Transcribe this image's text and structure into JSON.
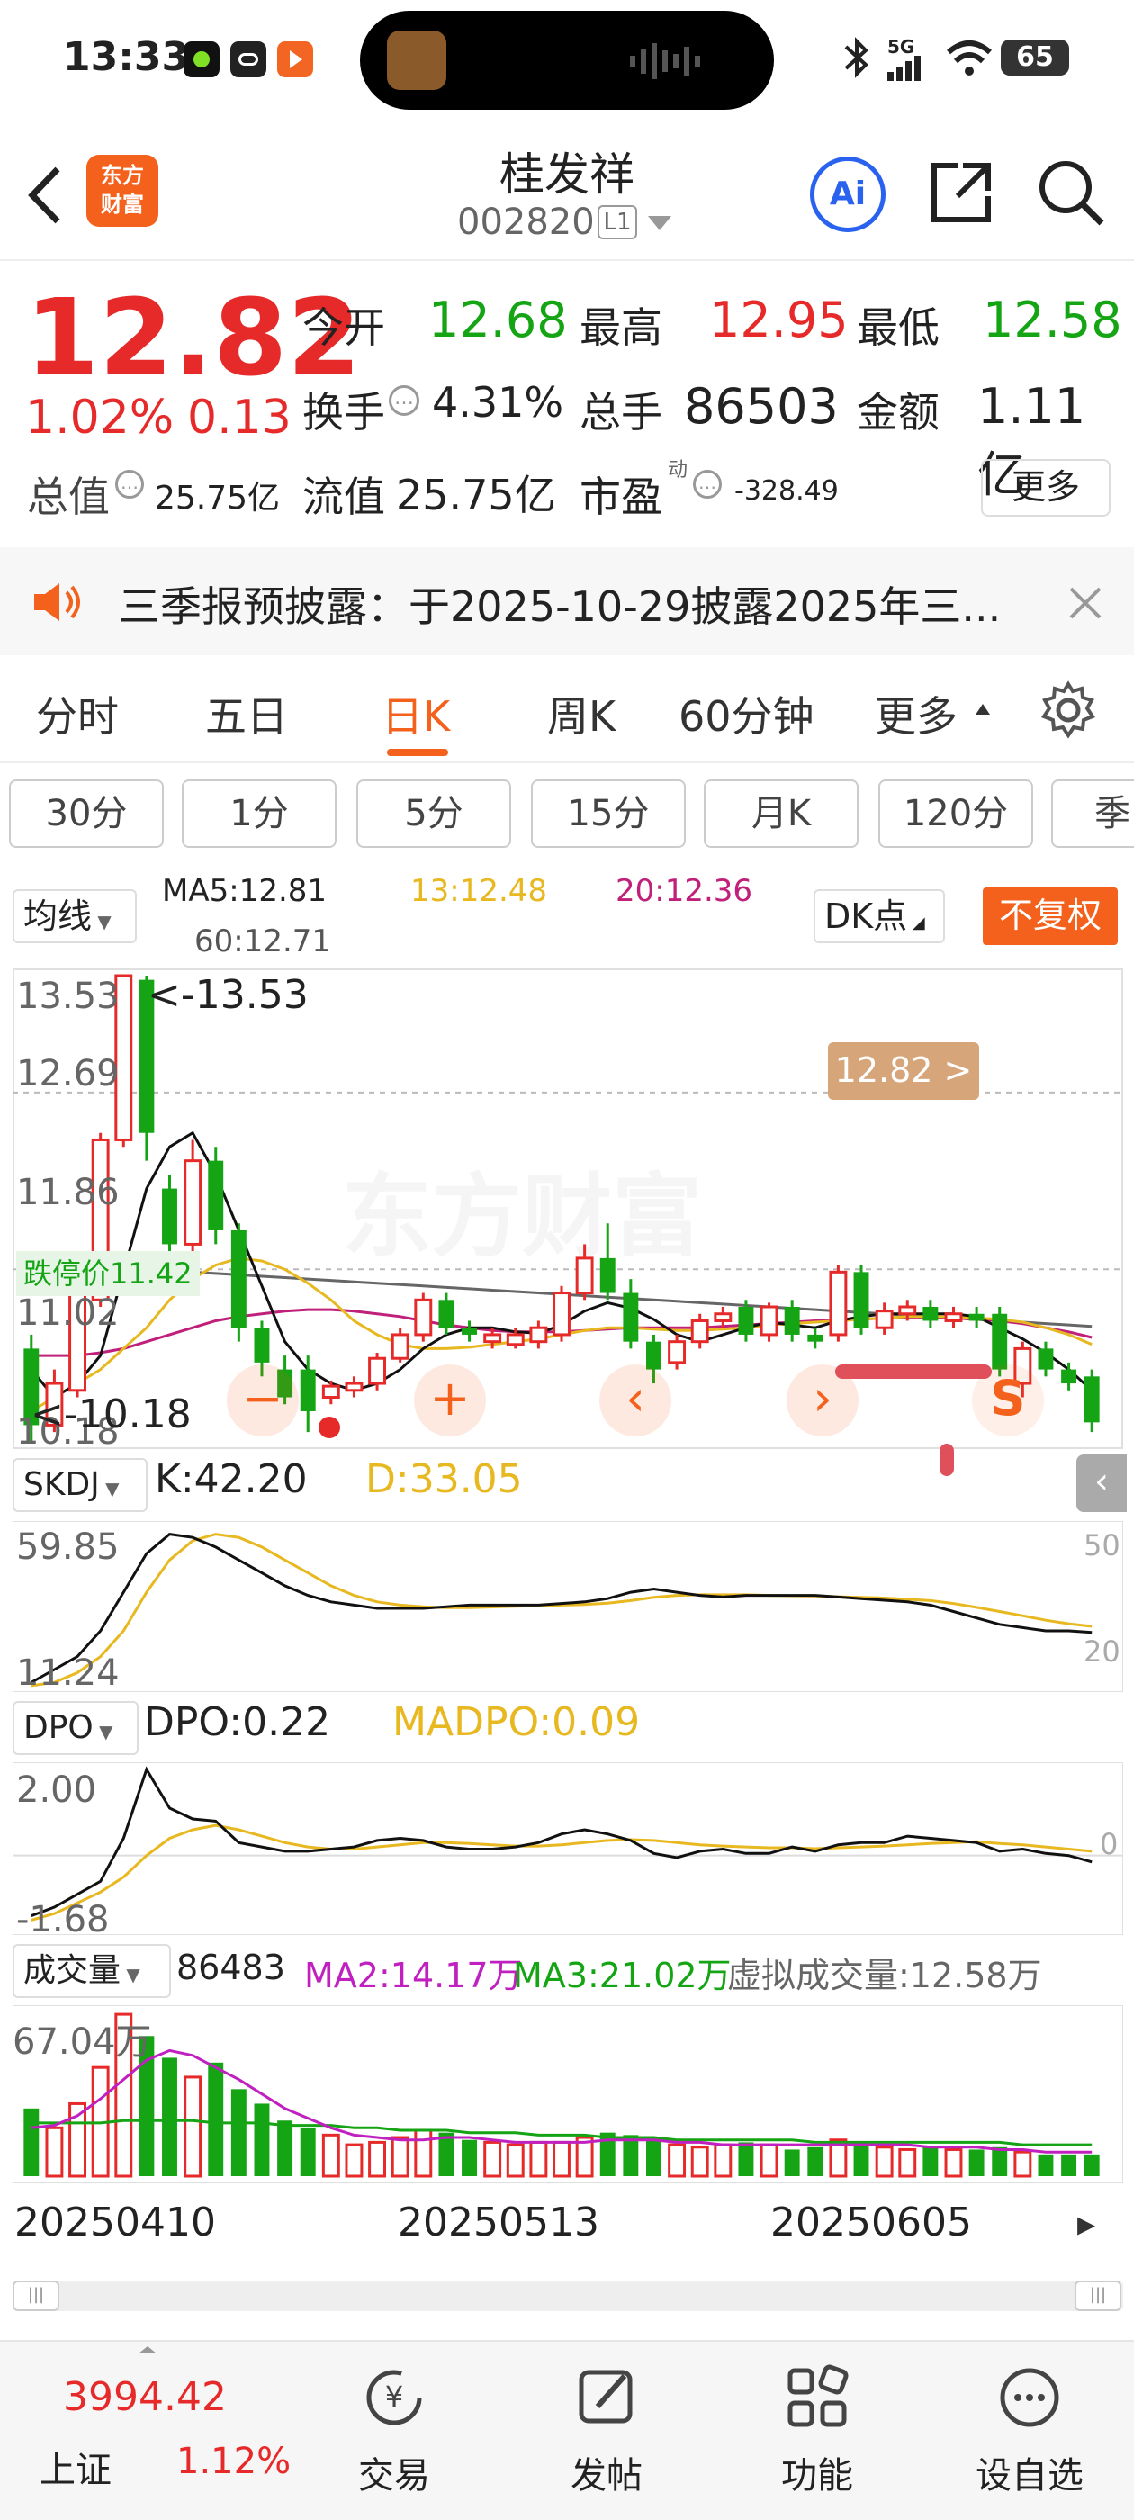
{
  "status": {
    "time": "13:33",
    "signal": "5G",
    "battery": "65"
  },
  "stock": {
    "name": "桂发祥",
    "code": "002820",
    "level": "L1",
    "logo_text_1": "东方",
    "logo_text_2": "财富",
    "ai": "Ai"
  },
  "quote": {
    "price": "12.82",
    "change_pct": "1.02%",
    "change": "0.13",
    "open_label": "今开",
    "open": "12.68",
    "high_label": "最高",
    "high": "12.95",
    "low_label": "最低",
    "low": "12.58",
    "turnover_label": "换手",
    "turnover": "4.31%",
    "volume_label": "总手",
    "volume": "86503",
    "amount_label": "金额",
    "amount": "1.11亿",
    "mktcap_label": "总值",
    "mktcap": "25.75亿",
    "float_label": "流值",
    "float": "25.75亿",
    "pe_label": "市盈",
    "pe_sup": "动",
    "pe": "-328.49",
    "more": "更多"
  },
  "notice": {
    "text": "三季报预披露：于2025-10-29披露2025年三..."
  },
  "tabs": [
    "分时",
    "五日",
    "日K",
    "周K",
    "60分钟",
    "更多"
  ],
  "active_tab": "日K",
  "periods": [
    "30分",
    "1分",
    "5分",
    "15分",
    "月K",
    "120分",
    "季"
  ],
  "ma": {
    "selector": "均线",
    "ma5": "MA5:12.81",
    "ma13": "13:12.48",
    "ma20": "20:12.36",
    "ma60": "60:12.71",
    "dk": "DK点",
    "fq": "不复权"
  },
  "kline": {
    "y_max": "13.53",
    "y_12_69": "12.69",
    "y_11_86": "11.86",
    "y_11_02": "11.02",
    "y_min": "10.18",
    "high_marker": "<-13.53",
    "low_marker": "<-10.18",
    "current_tag": "12.82 >",
    "limit_down": "跌停价11.42",
    "watermark": "东方财富"
  },
  "skdj": {
    "name": "SKDJ",
    "k": "K:42.20",
    "d": "D:33.05",
    "y_top": "59.85",
    "y_bot": "11.24",
    "r50": "50",
    "r20": "20"
  },
  "dpo": {
    "name": "DPO",
    "dpo": "DPO:0.22",
    "madpo": "MADPO:0.09",
    "y_top": "2.00",
    "y_bot": "-1.68",
    "r0": "0"
  },
  "vol": {
    "name": "成交量",
    "v": "86483",
    "ma2": "MA2:14.17万",
    "ma3": "MA3:21.02万",
    "virtual": "虚拟成交量:12.58万",
    "y_top": "67.04万"
  },
  "dates": [
    "20250410",
    "20250513",
    "20250605"
  ],
  "market": {
    "index": "3994.42",
    "name": "上证",
    "pct": "1.12%"
  },
  "bottom_nav": [
    "交易",
    "发帖",
    "功能",
    "设自选"
  ],
  "colors": {
    "up": "#e62a2a",
    "down": "#14a414",
    "accent": "#f3611c",
    "ma13": "#e8b820",
    "ma20": "#c0207a",
    "ma60": "#666666"
  },
  "chart_data": {
    "type": "candlestick",
    "candles": [
      {
        "o": 10.85,
        "c": 10.3,
        "h": 10.95,
        "l": 10.18
      },
      {
        "o": 10.3,
        "c": 10.6,
        "h": 10.7,
        "l": 10.25
      },
      {
        "o": 10.55,
        "c": 11.25,
        "h": 11.3,
        "l": 10.5
      },
      {
        "o": 11.2,
        "c": 12.35,
        "h": 12.4,
        "l": 11.15
      },
      {
        "o": 12.35,
        "c": 13.53,
        "h": 13.53,
        "l": 12.3
      },
      {
        "o": 13.5,
        "c": 12.4,
        "h": 13.53,
        "l": 12.2
      },
      {
        "o": 12.0,
        "c": 11.6,
        "h": 12.1,
        "l": 11.5
      },
      {
        "o": 11.6,
        "c": 12.2,
        "h": 12.35,
        "l": 11.55
      },
      {
        "o": 12.2,
        "c": 11.7,
        "h": 12.3,
        "l": 11.6
      },
      {
        "o": 11.7,
        "c": 11.0,
        "h": 11.75,
        "l": 10.9
      },
      {
        "o": 11.0,
        "c": 10.75,
        "h": 11.05,
        "l": 10.65
      },
      {
        "o": 10.7,
        "c": 10.5,
        "h": 10.8,
        "l": 10.45
      },
      {
        "o": 10.7,
        "c": 10.4,
        "h": 10.8,
        "l": 10.25
      },
      {
        "o": 10.5,
        "c": 10.58,
        "h": 10.62,
        "l": 10.45
      },
      {
        "o": 10.55,
        "c": 10.6,
        "h": 10.65,
        "l": 10.5
      },
      {
        "o": 10.6,
        "c": 10.78,
        "h": 10.82,
        "l": 10.55
      },
      {
        "o": 10.78,
        "c": 10.95,
        "h": 11.0,
        "l": 10.75
      },
      {
        "o": 10.95,
        "c": 11.2,
        "h": 11.25,
        "l": 10.9
      },
      {
        "o": 11.2,
        "c": 11.0,
        "h": 11.25,
        "l": 10.95
      },
      {
        "o": 11.0,
        "c": 10.95,
        "h": 11.05,
        "l": 10.9
      },
      {
        "o": 10.9,
        "c": 10.95,
        "h": 11.0,
        "l": 10.85
      },
      {
        "o": 10.88,
        "c": 10.95,
        "h": 11.0,
        "l": 10.85
      },
      {
        "o": 10.9,
        "c": 11.0,
        "h": 11.05,
        "l": 10.85
      },
      {
        "o": 10.95,
        "c": 11.25,
        "h": 11.3,
        "l": 10.9
      },
      {
        "o": 11.25,
        "c": 11.5,
        "h": 11.6,
        "l": 11.2
      },
      {
        "o": 11.5,
        "c": 11.25,
        "h": 11.75,
        "l": 11.2
      },
      {
        "o": 11.25,
        "c": 10.9,
        "h": 11.35,
        "l": 10.85
      },
      {
        "o": 10.9,
        "c": 10.7,
        "h": 10.95,
        "l": 10.6
      },
      {
        "o": 10.75,
        "c": 10.9,
        "h": 10.95,
        "l": 10.7
      },
      {
        "o": 10.9,
        "c": 11.05,
        "h": 11.1,
        "l": 10.85
      },
      {
        "o": 11.05,
        "c": 11.1,
        "h": 11.15,
        "l": 11.0
      },
      {
        "o": 11.15,
        "c": 10.95,
        "h": 11.2,
        "l": 10.9
      },
      {
        "o": 10.95,
        "c": 11.15,
        "h": 11.18,
        "l": 10.9
      },
      {
        "o": 11.15,
        "c": 10.95,
        "h": 11.2,
        "l": 10.9
      },
      {
        "o": 10.95,
        "c": 10.9,
        "h": 11.0,
        "l": 10.85
      },
      {
        "o": 10.95,
        "c": 11.4,
        "h": 11.45,
        "l": 10.9
      },
      {
        "o": 11.4,
        "c": 11.0,
        "h": 11.45,
        "l": 10.95
      },
      {
        "o": 11.0,
        "c": 11.12,
        "h": 11.18,
        "l": 10.95
      },
      {
        "o": 11.1,
        "c": 11.15,
        "h": 11.2,
        "l": 11.05
      },
      {
        "o": 11.15,
        "c": 11.05,
        "h": 11.2,
        "l": 11.0
      },
      {
        "o": 11.05,
        "c": 11.1,
        "h": 11.15,
        "l": 11.0
      },
      {
        "o": 11.1,
        "c": 11.05,
        "h": 11.15,
        "l": 11.0
      },
      {
        "o": 11.1,
        "c": 10.7,
        "h": 11.15,
        "l": 10.65
      },
      {
        "o": 10.6,
        "c": 10.85,
        "h": 10.9,
        "l": 10.5
      },
      {
        "o": 10.85,
        "c": 10.7,
        "h": 10.9,
        "l": 10.65
      },
      {
        "o": 10.7,
        "c": 10.6,
        "h": 10.75,
        "l": 10.55
      },
      {
        "o": 10.65,
        "c": 10.32,
        "h": 10.7,
        "l": 10.25
      }
    ],
    "ma5": [
      10.7,
      10.5,
      10.6,
      10.8,
      11.4,
      12.0,
      12.3,
      12.4,
      12.1,
      11.7,
      11.3,
      10.9,
      10.7,
      10.6,
      10.55,
      10.6,
      10.7,
      10.85,
      10.95,
      11.0,
      11.0,
      10.97,
      10.96,
      11.02,
      11.12,
      11.18,
      11.14,
      11.06,
      10.95,
      10.9,
      10.95,
      11.0,
      11.04,
      11.02,
      11.0,
      11.05,
      11.08,
      11.1,
      11.1,
      11.1,
      11.1,
      11.08,
      11.0,
      10.92,
      10.82,
      10.7,
      10.55
    ],
    "ma13": [
      10.4,
      10.5,
      10.6,
      10.7,
      10.85,
      11.0,
      11.2,
      11.35,
      11.45,
      11.5,
      11.48,
      11.42,
      11.32,
      11.2,
      11.05,
      10.95,
      10.88,
      10.85,
      10.85,
      10.86,
      10.88,
      10.9,
      10.92,
      10.95,
      10.98,
      11.0,
      11.0,
      10.99,
      10.98,
      10.98,
      10.99,
      11.0,
      11.02,
      11.03,
      11.04,
      11.05,
      11.06,
      11.07,
      11.08,
      11.08,
      11.08,
      11.07,
      11.06,
      11.04,
      11.0,
      10.95,
      10.88
    ],
    "ma20": [
      10.8,
      10.8,
      10.8,
      10.82,
      10.85,
      10.9,
      10.95,
      11.0,
      11.05,
      11.08,
      11.1,
      11.12,
      11.13,
      11.13,
      11.12,
      11.1,
      11.08,
      11.05,
      11.02,
      11.0,
      10.98,
      10.97,
      10.97,
      10.97,
      10.98,
      10.99,
      11.0,
      11.0,
      11.0,
      11.0,
      11.01,
      11.02,
      11.03,
      11.04,
      11.05,
      11.06,
      11.06,
      11.07,
      11.07,
      11.07,
      11.07,
      11.06,
      11.05,
      11.03,
      11.0,
      10.97,
      10.93
    ],
    "ma60": [
      11.5,
      11.48,
      11.46,
      11.44,
      11.43,
      11.42,
      11.41,
      11.4,
      11.39,
      11.38,
      11.37,
      11.36,
      11.35,
      11.34,
      11.33,
      11.32,
      11.31,
      11.3,
      11.29,
      11.28,
      11.27,
      11.26,
      11.25,
      11.24,
      11.23,
      11.22,
      11.21,
      11.2,
      11.19,
      11.18,
      11.17,
      11.16,
      11.15,
      11.14,
      11.13,
      11.12,
      11.11,
      11.1,
      11.09,
      11.08,
      11.07,
      11.06,
      11.05,
      11.04,
      11.03,
      11.02,
      11.01
    ],
    "skdj_k": [
      12,
      16,
      20,
      28,
      40,
      52,
      58,
      57,
      54,
      50,
      46,
      42,
      39,
      37,
      36,
      35,
      35,
      35,
      35.5,
      36,
      36,
      36,
      36,
      36.5,
      37,
      38,
      40,
      41,
      40,
      39,
      38.5,
      39,
      39,
      39,
      39,
      38.5,
      38,
      37.5,
      37,
      36,
      34,
      32,
      30,
      29,
      28,
      28,
      27.5
    ],
    "skdj_d": [
      11,
      12,
      15,
      20,
      28,
      40,
      50,
      56,
      58,
      57,
      54,
      50,
      46,
      42,
      39,
      37,
      36,
      35.5,
      35.2,
      35.2,
      35.4,
      35.6,
      35.8,
      36,
      36.2,
      36.6,
      37.4,
      38.4,
      39,
      39.2,
      39.2,
      39.2,
      39,
      38.9,
      38.8,
      38.6,
      38.4,
      38.2,
      37.8,
      37.4,
      36.5,
      35.3,
      34,
      32.7,
      31.3,
      30.2,
      29.4
    ],
    "dpo": [
      -1.4,
      -1.2,
      -0.9,
      -0.6,
      0.4,
      2.0,
      1.1,
      0.85,
      0.8,
      0.3,
      0.2,
      0.1,
      0.1,
      0.15,
      0.2,
      0.35,
      0.4,
      0.35,
      0.2,
      0.15,
      0.15,
      0.2,
      0.3,
      0.5,
      0.6,
      0.5,
      0.35,
      0.05,
      -0.05,
      0.1,
      0.15,
      0.05,
      0.05,
      0.2,
      0.1,
      0.25,
      0.3,
      0.3,
      0.45,
      0.4,
      0.35,
      0.3,
      0.1,
      0.15,
      0.05,
      0.0,
      -0.15
    ],
    "madpo": [
      -1.5,
      -1.35,
      -1.1,
      -0.85,
      -0.5,
      0.0,
      0.4,
      0.6,
      0.7,
      0.6,
      0.45,
      0.3,
      0.2,
      0.15,
      0.15,
      0.2,
      0.25,
      0.3,
      0.3,
      0.28,
      0.25,
      0.22,
      0.22,
      0.25,
      0.3,
      0.35,
      0.37,
      0.35,
      0.3,
      0.25,
      0.22,
      0.2,
      0.18,
      0.18,
      0.16,
      0.18,
      0.2,
      0.22,
      0.25,
      0.28,
      0.3,
      0.32,
      0.28,
      0.25,
      0.2,
      0.15,
      0.1
    ],
    "volume": [
      28,
      20,
      30,
      45,
      67,
      58,
      49,
      41,
      47,
      36,
      30,
      23,
      20,
      17,
      13,
      14,
      16,
      19,
      18,
      15,
      14,
      13,
      14,
      14,
      16,
      18,
      17,
      15,
      13,
      12,
      13,
      14,
      13,
      11,
      12,
      15,
      14,
      12,
      11,
      12,
      11,
      11,
      12,
      10,
      9,
      9,
      9
    ],
    "vol_ma": [
      20,
      21,
      25,
      32,
      40,
      48,
      52,
      50,
      45,
      40,
      34,
      28,
      24,
      20,
      17,
      16,
      15,
      15,
      16,
      16,
      15,
      14,
      14,
      14,
      14,
      15,
      15,
      15,
      14,
      14,
      13,
      13,
      13,
      13,
      13,
      13,
      13,
      13,
      13,
      12,
      12,
      12,
      11,
      11,
      10,
      10,
      10
    ],
    "vol_ma_long": [
      22,
      22,
      22,
      22,
      23,
      23,
      23,
      23,
      22,
      22,
      22,
      21,
      21,
      21,
      20,
      20,
      19,
      19,
      19,
      18,
      18,
      18,
      17,
      17,
      17,
      16,
      16,
      16,
      15,
      15,
      15,
      15,
      15,
      15,
      14,
      14,
      14,
      14,
      14,
      14,
      14,
      14,
      14,
      13,
      13,
      13,
      13
    ]
  }
}
